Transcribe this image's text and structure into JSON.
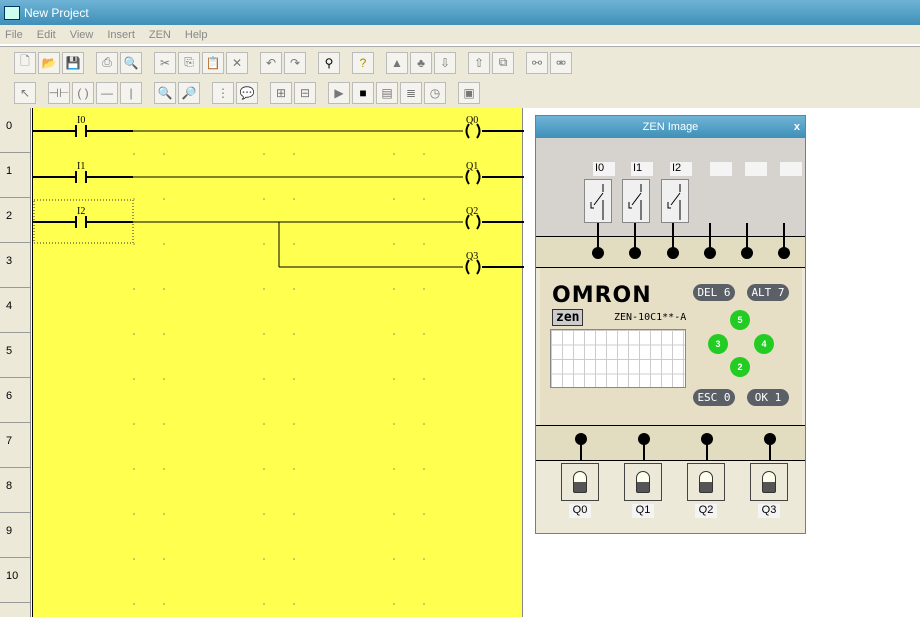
{
  "window": {
    "title": "New Project"
  },
  "menu": [
    "File",
    "Edit",
    "View",
    "Insert",
    "ZEN",
    "Help"
  ],
  "toolbar1": [
    "new",
    "open",
    "save",
    "print",
    "print-preview",
    "cut",
    "copy",
    "paste",
    "delete",
    "undo",
    "redo",
    "find",
    "help",
    "mode-a",
    "mode-b",
    "transfer-1",
    "transfer-2",
    "compare",
    "connect",
    "disconnect"
  ],
  "toolbar2": [
    "select",
    "contact",
    "coil",
    "horizontal-line",
    "vertical-line",
    "zoom-out",
    "zoom-in",
    "grid",
    "comment",
    "tool-a",
    "tool-b",
    "run",
    "stop",
    "monitor",
    "list",
    "timer",
    "zen-image"
  ],
  "rows": [
    "0",
    "1",
    "2",
    "3",
    "4",
    "5",
    "6",
    "7",
    "8",
    "9",
    "10"
  ],
  "ladder": {
    "contacts": [
      "I0",
      "I1",
      "I2"
    ],
    "coils": [
      "Q0",
      "Q1",
      "Q2",
      "Q3"
    ]
  },
  "zen": {
    "title": "ZEN Image",
    "close": "x",
    "inputs": [
      "I0",
      "I1",
      "I2"
    ],
    "brand": "OMRON",
    "logo": "zen",
    "model": "ZEN-10C1**-A",
    "buttons": {
      "del": "DEL 6",
      "alt": "ALT 7",
      "esc": "ESC 0",
      "ok": "OK  1",
      "up": "5",
      "left": "3",
      "right": "4",
      "down": "2"
    },
    "outputs": [
      "Q0",
      "Q1",
      "Q2",
      "Q3"
    ]
  }
}
